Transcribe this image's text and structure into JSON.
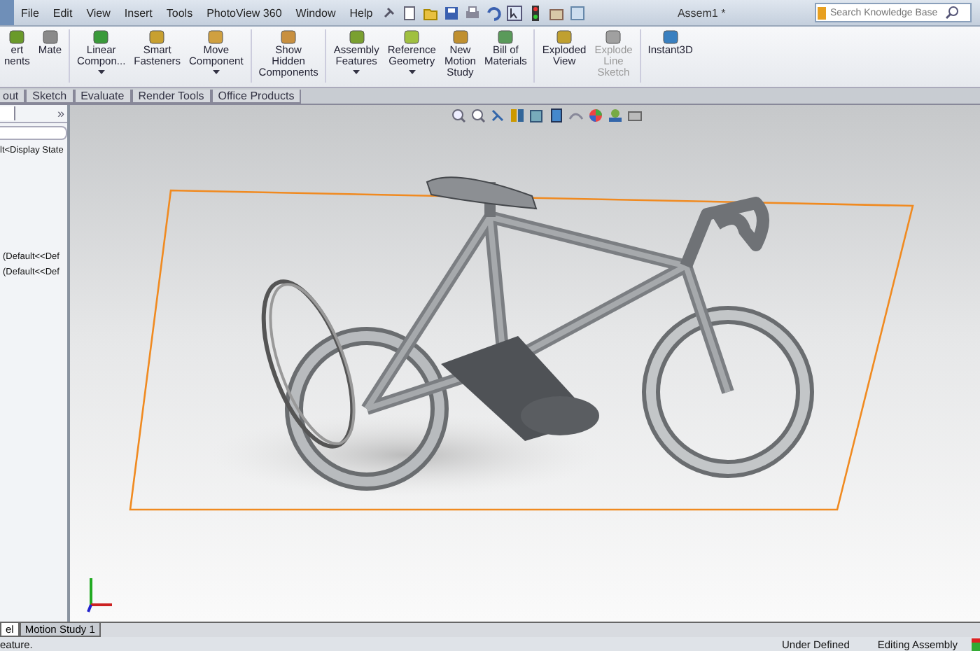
{
  "window": {
    "title": "Assem1 *"
  },
  "menu": [
    "File",
    "Edit",
    "View",
    "Insert",
    "Tools",
    "PhotoView 360",
    "Window",
    "Help"
  ],
  "search": {
    "placeholder": "Search Knowledge Base"
  },
  "ribbon": [
    {
      "label": "ert\nnents",
      "has_menu": false,
      "disabled": false,
      "color": "#6a9a2a"
    },
    {
      "label": "Mate",
      "has_menu": false,
      "disabled": false,
      "color": "#8a8a8a"
    },
    {
      "label": "Linear\nCompon...",
      "has_menu": true,
      "disabled": false,
      "color": "#3a9a3a"
    },
    {
      "label": "Smart\nFasteners",
      "has_menu": false,
      "disabled": false,
      "color": "#c8a030"
    },
    {
      "label": "Move\nComponent",
      "has_menu": true,
      "disabled": false,
      "color": "#d0a040"
    },
    {
      "label": "Show\nHidden\nComponents",
      "has_menu": false,
      "disabled": false,
      "color": "#c89040"
    },
    {
      "label": "Assembly\nFeatures",
      "has_menu": true,
      "disabled": false,
      "color": "#7aa030"
    },
    {
      "label": "Reference\nGeometry",
      "has_menu": true,
      "disabled": false,
      "color": "#a0c040"
    },
    {
      "label": "New\nMotion\nStudy",
      "has_menu": false,
      "disabled": false,
      "color": "#c09030"
    },
    {
      "label": "Bill of\nMaterials",
      "has_menu": false,
      "disabled": false,
      "color": "#5a9a5a"
    },
    {
      "label": "Exploded\nView",
      "has_menu": false,
      "disabled": false,
      "color": "#c0a030"
    },
    {
      "label": "Explode\nLine\nSketch",
      "has_menu": false,
      "disabled": true,
      "color": "#a0a0a0"
    },
    {
      "label": "Instant3D",
      "has_menu": false,
      "disabled": false,
      "color": "#3a80c0"
    }
  ],
  "tabs": [
    {
      "label": "out",
      "selected": false
    },
    {
      "label": "Sketch",
      "selected": false
    },
    {
      "label": "Evaluate",
      "selected": false
    },
    {
      "label": "Render Tools",
      "selected": false
    },
    {
      "label": "Office Products",
      "selected": false
    }
  ],
  "panel": {
    "expand": "»",
    "items": [
      "lt<Display State",
      "(Default<<Def",
      "(Default<<Def"
    ]
  },
  "bottom_tabs": [
    {
      "label": "el",
      "selected": true
    },
    {
      "label": "Motion Study 1",
      "selected": false
    }
  ],
  "status_bar": {
    "message": "eature.",
    "state": "Under Defined",
    "mode": "Editing Assembly"
  }
}
